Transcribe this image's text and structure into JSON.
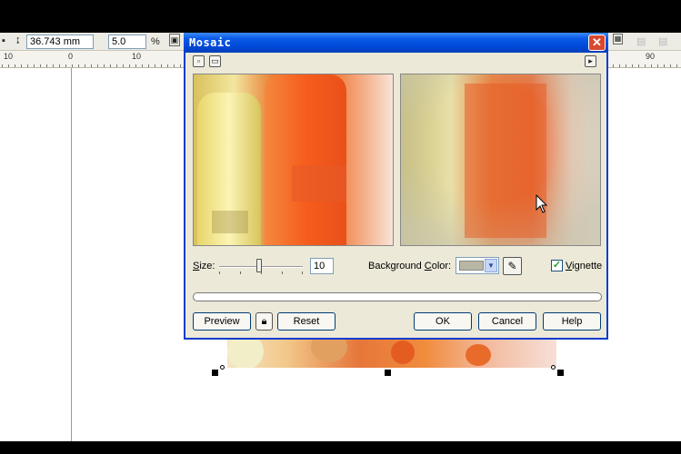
{
  "app": {
    "property_bar": {
      "dimension_value": "36.743 mm",
      "scale_value": "5.0",
      "percent_symbol": "%"
    },
    "ruler": {
      "labels": [
        "10",
        "0",
        "10",
        "90"
      ]
    }
  },
  "dialog": {
    "title": "Mosaic",
    "close_glyph": "✕",
    "size_label_prefix": "S",
    "size_label_rest": "ize:",
    "size_value": "10",
    "background_color_label_prefix": "Background ",
    "background_color_label_accel": "C",
    "background_color_label_rest": "olor:",
    "background_color": "#b8b6a4",
    "vignette_label_accel": "V",
    "vignette_label_rest": "ignette",
    "vignette_checked": true,
    "buttons": {
      "preview": "Preview",
      "reset": "Reset",
      "ok": "OK",
      "cancel": "Cancel",
      "help": "Help"
    }
  },
  "colors": {
    "title_bar": "#0a5ae8",
    "dialog_bg": "#ece9d8",
    "close_red": "#d8492f"
  },
  "icons": [
    "layout-icon",
    "expand-icon",
    "play-icon",
    "lock-icon",
    "eyedropper-icon",
    "dropdown-arrow-icon",
    "mouse-cursor-icon"
  ]
}
